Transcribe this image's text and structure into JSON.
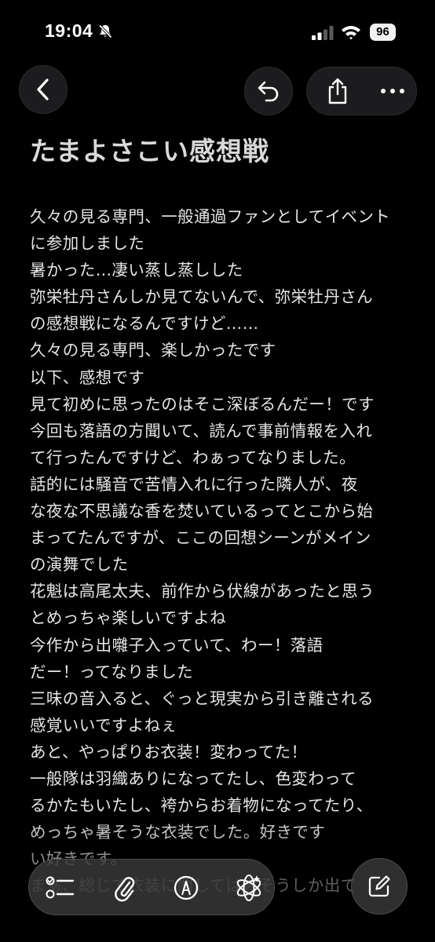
{
  "status_bar": {
    "time": "19:04",
    "battery": "96",
    "icons": [
      "bell-slash-icon",
      "cellular-signal-icon",
      "wifi-icon",
      "battery-icon"
    ]
  },
  "nav": {
    "icons": [
      "chevron-left-icon",
      "undo-icon",
      "share-icon",
      "more-icon"
    ]
  },
  "note": {
    "title": "たまよさこい感想戦",
    "lines": [
      "久々の見る専門、一般通過ファンとしてイベント",
      "に参加しました",
      "暑かった…凄い蒸し蒸しした",
      "弥栄牡丹さんしか見てないんで、弥栄牡丹さん",
      "の感想戦になるんですけど……",
      "久々の見る専門、楽しかったです",
      "以下、感想です",
      "見て初めに思ったのはそこ深ぼるんだー！です",
      "今回も落語の方聞いて、読んで事前情報を入れ",
      "て行ったんですけど、わぁってなりました。",
      "話的には騒音で苦情入れに行った隣人が、夜",
      "な夜な不思議な香を焚いているってとこから始",
      "まってたんですが、ここの回想シーンがメイン",
      "の演舞でした",
      "花魁は高尾太夫、前作から伏線があったと思う",
      "とめっちゃ楽しいですよね",
      "今作から出囃子入っていて、わー！落語",
      "だー！ってなりました",
      "三味の音入ると、ぐっと現実から引き離される",
      "感覚いいですよねぇ",
      "あと、やっぱりお衣装！変わってた！",
      "一般隊は羽織ありになってたし、色変わって",
      "るかたもいたし、袴からお着物になってたり、",
      "めっちゃ暑そうな衣装でした。好きです",
      "い好きです。",
      "まぁ、総じて衣装に関しては暑そうしか出て"
    ]
  },
  "toolbar": {
    "icons": [
      "checklist-icon",
      "paperclip-icon",
      "markup-pen-icon",
      "apple-intelligence-icon",
      "compose-icon"
    ]
  }
}
